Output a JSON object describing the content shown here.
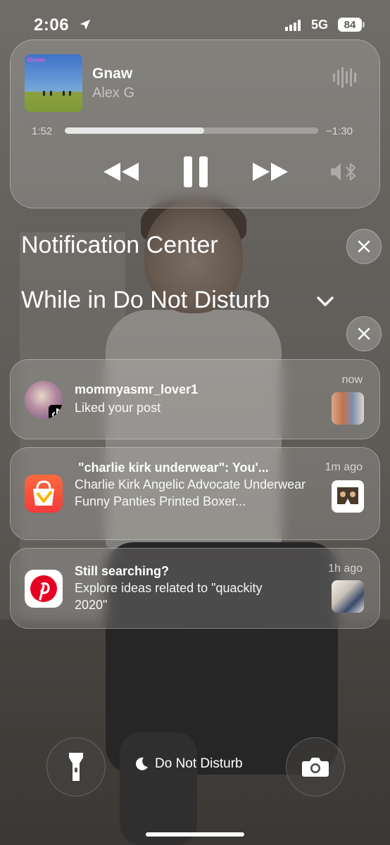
{
  "status_bar": {
    "time": "2:06",
    "network": "5G",
    "battery": "84",
    "icons": [
      "location-arrow-icon",
      "signal-bars-icon"
    ]
  },
  "now_playing": {
    "album_art_text": "Gnaw",
    "title": "Gnaw",
    "artist": "Alex G",
    "elapsed": "1:52",
    "remaining": "−1:30",
    "progress_fraction": 0.55,
    "controls": [
      "rewind-icon",
      "pause-icon",
      "fast-forward-icon",
      "airplay-icon"
    ]
  },
  "notification_center": {
    "title": "Notification Center",
    "focus_group_title": "While in Do Not Disturb"
  },
  "notifications": [
    {
      "app_icon": "tiktok-icon",
      "title": "mommyasmr_lover1",
      "body": "Liked your post",
      "time": "now"
    },
    {
      "app_icon": "shopping-bag-icon",
      "title": "\"charlie kirk underwear\": You'...",
      "body": "Charlie Kirk Angelic Advocate Underwear  Funny Panties Printed Boxer...",
      "time": "1m ago"
    },
    {
      "app_icon": "pinterest-icon",
      "title": "Still searching?",
      "body": "Explore ideas related to \"quackity 2020\"",
      "time": "1h ago"
    }
  ],
  "bottom": {
    "focus_label": "Do Not Disturb",
    "left_button_icon": "flashlight-icon",
    "right_button_icon": "camera-icon"
  }
}
